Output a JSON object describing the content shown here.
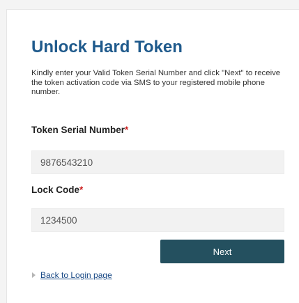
{
  "form": {
    "title": "Unlock Hard Token",
    "description": "Kindly enter your Valid Token Serial Number and click \"Next\" to receive the token activation code via SMS to your registered mobile phone number.",
    "serial_label": "Token Serial Number",
    "serial_value": "9876543210",
    "lock_label": "Lock Code",
    "lock_value": "1234500",
    "required_marker": "*",
    "next_label": "Next",
    "back_link_label": "Back to Login page"
  },
  "icons": {
    "back_link": "triangle-right-icon"
  },
  "colors": {
    "title": "#1f5a8c",
    "required": "#cc1f1f",
    "button_bg": "#24505f",
    "link": "#1a4a86"
  }
}
